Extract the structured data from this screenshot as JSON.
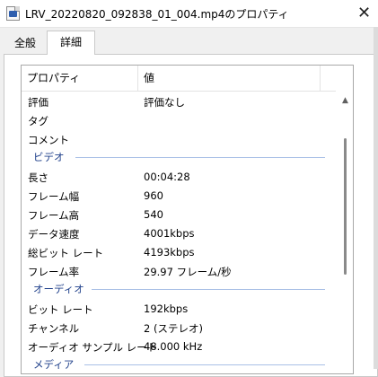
{
  "window": {
    "title": "LRV_20220820_092838_01_004.mp4のプロパティ",
    "close_glyph": "✕",
    "icon": "video-file-icon"
  },
  "tabs": [
    {
      "label": "全般",
      "active": false
    },
    {
      "label": "詳細",
      "active": true
    }
  ],
  "details": {
    "columns": {
      "property": "プロパティ",
      "value": "値"
    },
    "rows_top": [
      {
        "key": "評価",
        "value": "評価なし"
      },
      {
        "key": "タグ",
        "value": ""
      },
      {
        "key": "コメント",
        "value": ""
      }
    ],
    "groups": {
      "video": {
        "label": "ビデオ",
        "rows": [
          {
            "key": "長さ",
            "value": "00:04:28"
          },
          {
            "key": "フレーム幅",
            "value": "960"
          },
          {
            "key": "フレーム高",
            "value": "540"
          },
          {
            "key": "データ速度",
            "value": "4001kbps"
          },
          {
            "key": "総ビット レート",
            "value": "4193kbps"
          },
          {
            "key": "フレーム率",
            "value": "29.97 フレーム/秒"
          }
        ]
      },
      "audio": {
        "label": "オーディオ",
        "rows": [
          {
            "key": "ビット レート",
            "value": "192kbps"
          },
          {
            "key": "チャンネル",
            "value": "2 (ステレオ)"
          },
          {
            "key": "オーディオ サンプル レート",
            "value": "48.000 kHz"
          }
        ]
      },
      "media": {
        "label": "メディア"
      }
    }
  },
  "colors": {
    "group_label": "#1e3f8a",
    "group_line": "#a9c0e6"
  }
}
